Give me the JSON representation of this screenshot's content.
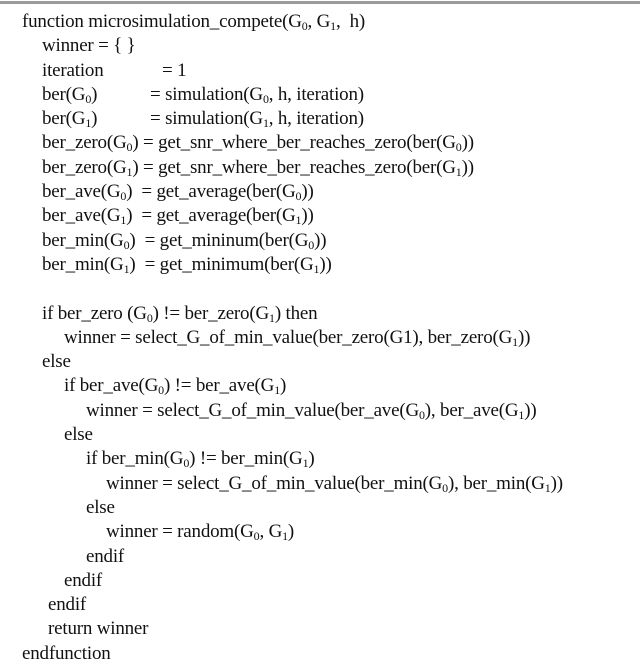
{
  "document": {
    "type": "pseudocode",
    "lines": [
      {
        "indent": 0,
        "parts": [
          [
            "function microsimulation_compete(G",
            "0",
            ", G",
            "1",
            ",  h)"
          ]
        ]
      },
      {
        "indent": 1,
        "parts": [
          [
            "winner = { }"
          ]
        ]
      },
      {
        "indent": 1,
        "lhs": [
          "iteration"
        ],
        "rhs": [
          "= 1"
        ]
      },
      {
        "indent": 1,
        "lhs": [
          "ber(G",
          "0",
          ")"
        ],
        "rhs": [
          "= simulation(G",
          "0",
          ", h, iteration)"
        ]
      },
      {
        "indent": 1,
        "lhs": [
          "ber(G",
          "1",
          ")"
        ],
        "rhs": [
          "= simulation(G",
          "1",
          ", h, iteration)"
        ]
      },
      {
        "indent": 1,
        "parts": [
          [
            "ber_zero(G",
            "0",
            ") = get_snr_where_ber_reaches_zero(ber(G",
            "0",
            "))"
          ]
        ]
      },
      {
        "indent": 1,
        "parts": [
          [
            "ber_zero(G",
            "1",
            ") = get_snr_where_ber_reaches_zero(ber(G",
            "1",
            "))"
          ]
        ]
      },
      {
        "indent": 1,
        "parts": [
          [
            "ber_ave(G",
            "0",
            ")  = get_average(ber(G",
            "0",
            "))"
          ]
        ]
      },
      {
        "indent": 1,
        "parts": [
          [
            "ber_ave(G",
            "1",
            ")  = get_average(ber(G",
            "1",
            "))"
          ]
        ]
      },
      {
        "indent": 1,
        "parts": [
          [
            "ber_min(G",
            "0",
            ")  = get_mininum(ber(G",
            "0",
            "))"
          ]
        ]
      },
      {
        "indent": 1,
        "parts": [
          [
            "ber_min(G",
            "1",
            ")  = get_minimum(ber(G",
            "1",
            "))"
          ]
        ]
      },
      {
        "indent": 1,
        "parts": [
          [
            ""
          ]
        ]
      },
      {
        "indent": 1,
        "parts": [
          [
            "if ber_zero (G",
            "0",
            ") != ber_zero(G",
            "1",
            ") then"
          ]
        ]
      },
      {
        "indent": 2,
        "parts": [
          [
            "winner = select_G_of_min_value(ber_zero(G1), ber_zero(G",
            "1",
            "))"
          ]
        ]
      },
      {
        "indent": 1,
        "parts": [
          [
            "else"
          ]
        ]
      },
      {
        "indent": 2,
        "parts": [
          [
            "if ber_ave(G",
            "0",
            ") != ber_ave(G",
            "1",
            ")"
          ]
        ]
      },
      {
        "indent": 3,
        "parts": [
          [
            "winner = select_G_of_min_value(ber_ave(G",
            "0",
            "), ber_ave(G",
            "1",
            "))"
          ]
        ]
      },
      {
        "indent": 2,
        "parts": [
          [
            "else"
          ]
        ]
      },
      {
        "indent": 3,
        "parts": [
          [
            "if ber_min(G",
            "0",
            ") != ber_min(G",
            "1",
            ")"
          ]
        ]
      },
      {
        "indent": 4,
        "parts": [
          [
            "winner = select_G_of_min_value(ber_min(G",
            "0",
            "), ber_min(G",
            "1",
            "))"
          ]
        ]
      },
      {
        "indent": 3,
        "parts": [
          [
            "else"
          ]
        ]
      },
      {
        "indent": 4,
        "parts": [
          [
            "winner = random(G",
            "0",
            ", G",
            "1",
            ")"
          ]
        ]
      },
      {
        "indent": 3,
        "parts": [
          [
            "endif"
          ]
        ]
      },
      {
        "indent": 2,
        "parts": [
          [
            "endif"
          ]
        ]
      },
      {
        "indent": "r1",
        "parts": [
          [
            "endif"
          ]
        ]
      },
      {
        "indent": "r1",
        "parts": [
          [
            "return winner"
          ]
        ]
      },
      {
        "indent": 0,
        "parts": [
          [
            "endfunction"
          ]
        ]
      }
    ]
  }
}
